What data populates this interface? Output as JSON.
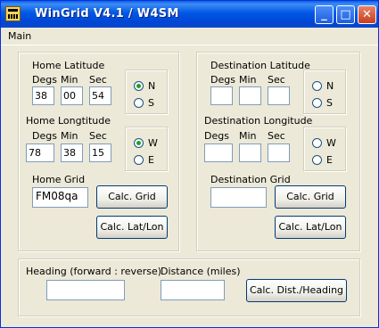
{
  "window": {
    "title": "WinGrid  V4.1 / W4SM"
  },
  "menu": {
    "items": [
      "Main"
    ]
  },
  "home": {
    "lat_label": "Home Latitude",
    "lon_label": "Home Longtitude",
    "col_degs": "Degs",
    "col_min": "Min",
    "col_sec": "Sec",
    "lat": {
      "degs": "38",
      "min": "00",
      "sec": "54"
    },
    "lon": {
      "degs": "78",
      "min": "38",
      "sec": "15"
    },
    "ns": {
      "n": "N",
      "s": "S",
      "selected": "N"
    },
    "we": {
      "w": "W",
      "e": "E",
      "selected": "W"
    },
    "grid_label": "Home Grid",
    "grid_value": "FM08qa",
    "calc_grid": "Calc. Grid",
    "calc_latlon": "Calc. Lat/Lon"
  },
  "dest": {
    "lat_label": "Destination Latitude",
    "lon_label": "Destination Longitude",
    "col_degs": "Degs",
    "col_min": "Min",
    "col_sec": "Sec",
    "lat": {
      "degs": "",
      "min": "",
      "sec": ""
    },
    "lon": {
      "degs": "",
      "min": "",
      "sec": ""
    },
    "ns": {
      "n": "N",
      "s": "S",
      "selected": ""
    },
    "we": {
      "w": "W",
      "e": "E",
      "selected": ""
    },
    "grid_label": "Destination Grid",
    "grid_value": "",
    "calc_grid": "Calc. Grid",
    "calc_latlon": "Calc. Lat/Lon"
  },
  "results": {
    "heading_label": "Heading (forward : reverse)",
    "heading_value": "",
    "distance_label": "Distance (miles)",
    "distance_value": "",
    "calc_button": "Calc. Dist./Heading"
  }
}
